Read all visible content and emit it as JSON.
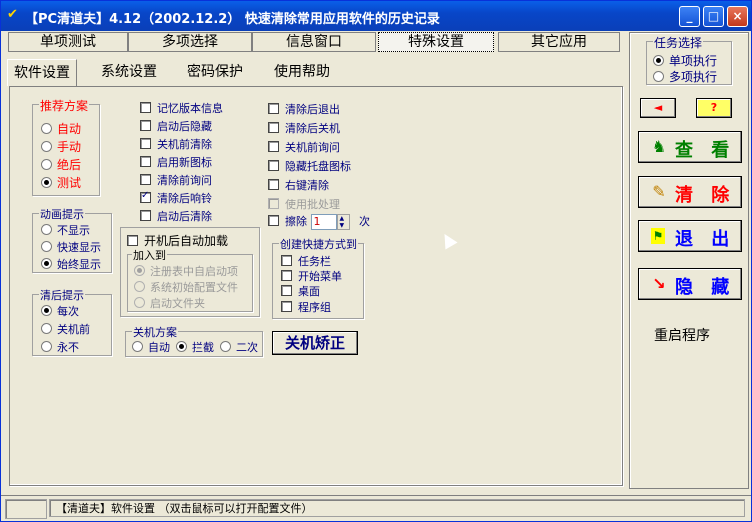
{
  "window": {
    "title": "【PC清道夫】4.12（2002.12.2） 快速清除常用应用软件的历史记录",
    "min": "_",
    "max": "□",
    "close": "×"
  },
  "main_tabs": [
    {
      "label": "单项测试"
    },
    {
      "label": "多项选择"
    },
    {
      "label": "信息窗口"
    },
    {
      "label": "特殊设置"
    },
    {
      "label": "其它应用"
    }
  ],
  "sub_tabs": [
    {
      "label": "软件设置"
    },
    {
      "label": "系统设置"
    },
    {
      "label": "密码保护"
    },
    {
      "label": "使用帮助"
    }
  ],
  "scheme": {
    "title": "推荐方案",
    "options": [
      "自动",
      "手动",
      "绝后",
      "测试"
    ],
    "selected": 3
  },
  "anim": {
    "title": "动画提示",
    "options": [
      "不显示",
      "快速显示",
      "始终显示"
    ],
    "selected": 2
  },
  "clearhint": {
    "title": "清后提示",
    "options": [
      "每次",
      "关机前",
      "永不"
    ],
    "selected": 0
  },
  "checks_mid": [
    {
      "label": "记忆版本信息",
      "checked": false
    },
    {
      "label": "启动后隐藏",
      "checked": false
    },
    {
      "label": "关机前清除",
      "checked": false
    },
    {
      "label": "启用新图标",
      "checked": false
    },
    {
      "label": "清除前询问",
      "checked": false
    },
    {
      "label": "清除后响铃",
      "checked": true
    },
    {
      "label": "启动后清除",
      "checked": false
    }
  ],
  "autoload": {
    "label": "开机后自动加载",
    "group_title": "加入到",
    "options": [
      "注册表中自启动项",
      "系统初始配置文件",
      "启动文件夹"
    ]
  },
  "shutdown": {
    "title": "关机方案",
    "options": [
      "自动",
      "拦截",
      "二次"
    ],
    "selected": 1
  },
  "checks_right": [
    {
      "label": "清除后退出",
      "checked": false
    },
    {
      "label": "清除后关机",
      "checked": false
    },
    {
      "label": "关机前询问",
      "checked": false
    },
    {
      "label": "隐藏托盘图标",
      "checked": false
    },
    {
      "label": "右键清除",
      "checked": false
    },
    {
      "label": "使用批处理",
      "checked": false,
      "disabled": true
    }
  ],
  "erase": {
    "label": "擦除",
    "value": "1",
    "unit": "次"
  },
  "shortcut": {
    "title": "创建快捷方式到",
    "options": [
      "任务栏",
      "开始菜单",
      "桌面",
      "程序组"
    ]
  },
  "shutdown_fix_label": "关机矫正",
  "task": {
    "title": "任务选择",
    "options": [
      "单项执行",
      "多项执行"
    ],
    "selected": 0
  },
  "right_buttons": {
    "back": "◄",
    "help": "?",
    "view": "查 看",
    "clear": "清 除",
    "exit": "退 出",
    "hide": "隐 藏",
    "restart": "重启程序"
  },
  "statusbar": {
    "text": "【清道夫】软件设置 （双击鼠标可以打开配置文件）"
  },
  "colors": {
    "red": "#ff0000",
    "navy": "#000080",
    "title_bar": "#0a4fd6"
  }
}
